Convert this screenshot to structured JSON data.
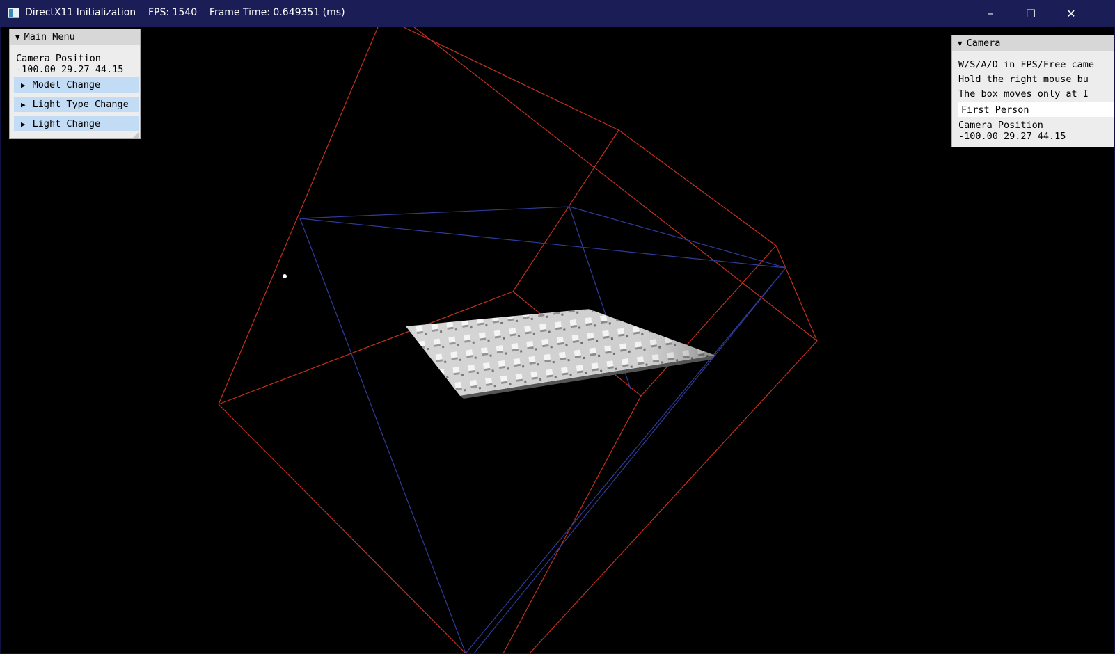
{
  "window": {
    "title": "DirectX11 Initialization    FPS: 1540    Frame Time: 0.649351 (ms)",
    "controls": {
      "minimize": "─",
      "maximize": "☐",
      "close": "✕"
    }
  },
  "main_menu": {
    "title": "Main Menu",
    "camera_position_label": "Camera Position",
    "camera_position_value": "-100.00 29.27 44.15",
    "items": [
      {
        "label": "Model Change"
      },
      {
        "label": "Light Type Change"
      },
      {
        "label": "Light Change"
      }
    ]
  },
  "camera_panel": {
    "title": "Camera",
    "help_lines": [
      "W/S/A/D in FPS/Free came",
      "Hold the right mouse bu",
      "The box moves only at I"
    ],
    "mode_selected": "First Person",
    "camera_position_label": "Camera Position",
    "camera_position_value": "-100.00 29.27 44.15"
  },
  "colors": {
    "titlebar": "#1b1d57",
    "viewport": "#000000",
    "frustum_red": "#c4311f",
    "frustum_blue": "#2f3c9a",
    "panel_bg": "#ededed",
    "tree_node_bg": "#c3dcf6"
  },
  "icons": {
    "app": "app-window-icon",
    "tree_collapsed": "triangle-right-icon",
    "tree_expanded": "triangle-down-icon"
  }
}
